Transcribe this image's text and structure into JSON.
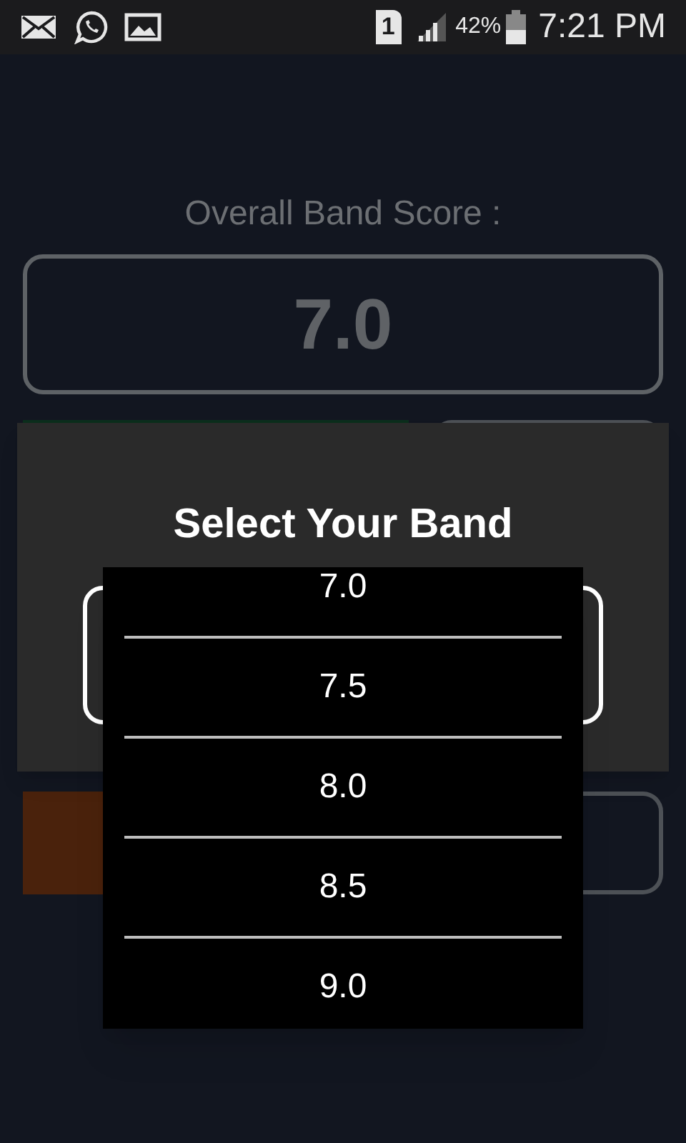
{
  "status_bar": {
    "sim": "1",
    "battery": "42%",
    "time": "7:21 PM"
  },
  "score": {
    "label": "Overall Band Score :",
    "value": "7.0"
  },
  "dialog": {
    "title": "Select Your Band",
    "options": [
      {
        "label": "7.0"
      },
      {
        "label": "7.5"
      },
      {
        "label": "8.0"
      },
      {
        "label": "8.5"
      },
      {
        "label": "9.0"
      }
    ]
  }
}
